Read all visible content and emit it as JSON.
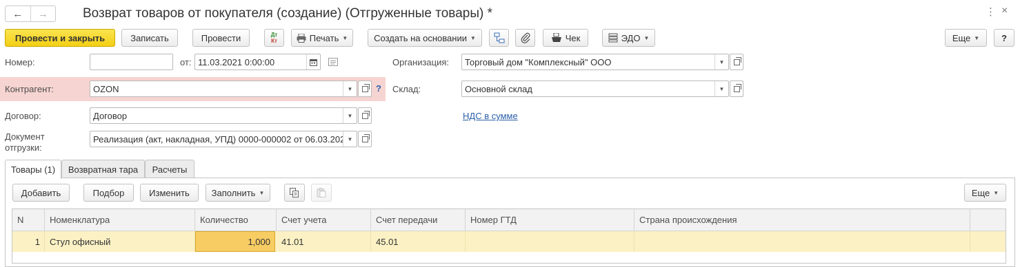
{
  "window": {
    "title": "Возврат товаров от покупателя (создание) (Отгруженные товары) *",
    "nav_back_icon": "arrow-left",
    "nav_forward_icon": "arrow-right"
  },
  "toolbar": {
    "post_and_close": "Провести и закрыть",
    "save": "Записать",
    "post": "Провести",
    "dt_kt_top": "Дт",
    "dt_kt_bottom": "Кт",
    "print": "Печать",
    "create_based_on": "Создать на основании",
    "receipt": "Чек",
    "edo": "ЭДО",
    "more": "Еще",
    "help": "?"
  },
  "form": {
    "number_label": "Номер:",
    "number_value": "",
    "date_from_label": "от:",
    "date_value": "11.03.2021  0:00:00",
    "organization_label": "Организация:",
    "organization_value": "Торговый дом \"Комплексный\" ООО",
    "counterparty_label": "Контрагент:",
    "counterparty_value": "OZON",
    "counterparty_help": "?",
    "warehouse_label": "Склад:",
    "warehouse_value": "Основной склад",
    "contract_label": "Договор:",
    "contract_value": "Договор",
    "vat_link": "НДС в сумме",
    "shipment_doc_label_1": "Документ",
    "shipment_doc_label_2": "отгрузки:",
    "shipment_doc_value": "Реализация (акт, накладная, УПД) 0000-000002 от 06.03.202"
  },
  "tabs": [
    {
      "label": "Товары (1)",
      "active": true
    },
    {
      "label": "Возвратная тара",
      "active": false
    },
    {
      "label": "Расчеты",
      "active": false
    }
  ],
  "table_toolbar": {
    "add": "Добавить",
    "selection": "Подбор",
    "change": "Изменить",
    "fill": "Заполнить",
    "more": "Еще"
  },
  "table": {
    "columns": [
      "N",
      "Номенклатура",
      "Количество",
      "Счет учета",
      "Счет передачи",
      "Номер ГТД",
      "Страна происхождения"
    ],
    "rows": [
      {
        "n": "1",
        "item": "Стул офисный",
        "qty": "1,000",
        "account": "41.01",
        "transfer_account": "45.01",
        "gtd": "",
        "country": ""
      }
    ]
  },
  "colors": {
    "primary_button": "#f3cf14",
    "required_highlight": "#f6d4d1",
    "selected_row": "#fbf1c4",
    "active_cell": "#f7cc63",
    "link": "#2b5fa8"
  }
}
